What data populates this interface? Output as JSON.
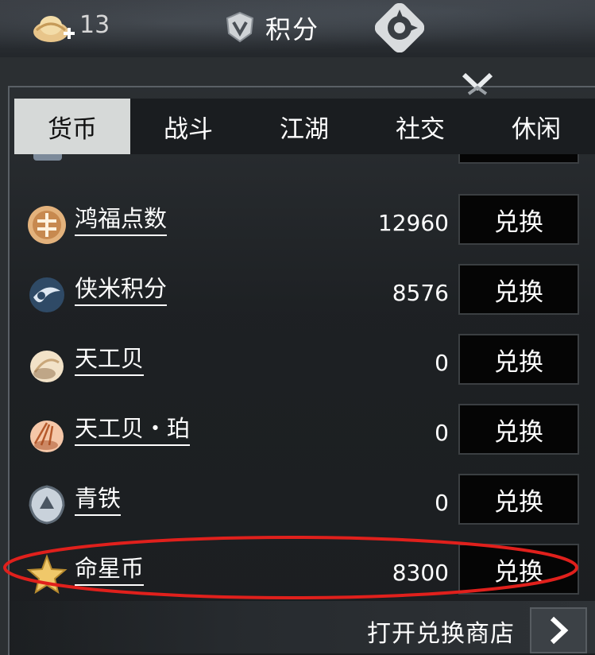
{
  "topbar": {
    "coin_count": "13",
    "score_label": "积分",
    "icons": [
      "ingot-plus-icon",
      "shield-score-icon",
      "emblem-icon"
    ]
  },
  "tabs": [
    {
      "label": "货币",
      "active": true
    },
    {
      "label": "战斗",
      "active": false
    },
    {
      "label": "江湖",
      "active": false
    },
    {
      "label": "社交",
      "active": false
    },
    {
      "label": "休闲",
      "active": false
    }
  ],
  "currencies": [
    {
      "name": "鸿福点数",
      "value": "12960",
      "button": "兑换",
      "icon": "fortune-coin-icon"
    },
    {
      "name": "侠米积分",
      "value": "8576",
      "button": "兑换",
      "icon": "swirl-emblem-icon"
    },
    {
      "name": "天工贝",
      "value": "0",
      "button": "兑换",
      "icon": "shell-icon"
    },
    {
      "name": "天工贝・珀",
      "value": "0",
      "button": "兑换",
      "icon": "amber-shell-icon"
    },
    {
      "name": "青铁",
      "value": "0",
      "button": "兑换",
      "icon": "iron-badge-icon"
    },
    {
      "name": "命星币",
      "value": "8300",
      "button": "兑换",
      "icon": "star-coin-icon"
    }
  ],
  "footer": {
    "open_shop_label": "打开兑换商店"
  },
  "colors": {
    "active_tab_bg": "#d6d9d8",
    "highlight": "#e0201c",
    "button_bg": "#050505"
  }
}
